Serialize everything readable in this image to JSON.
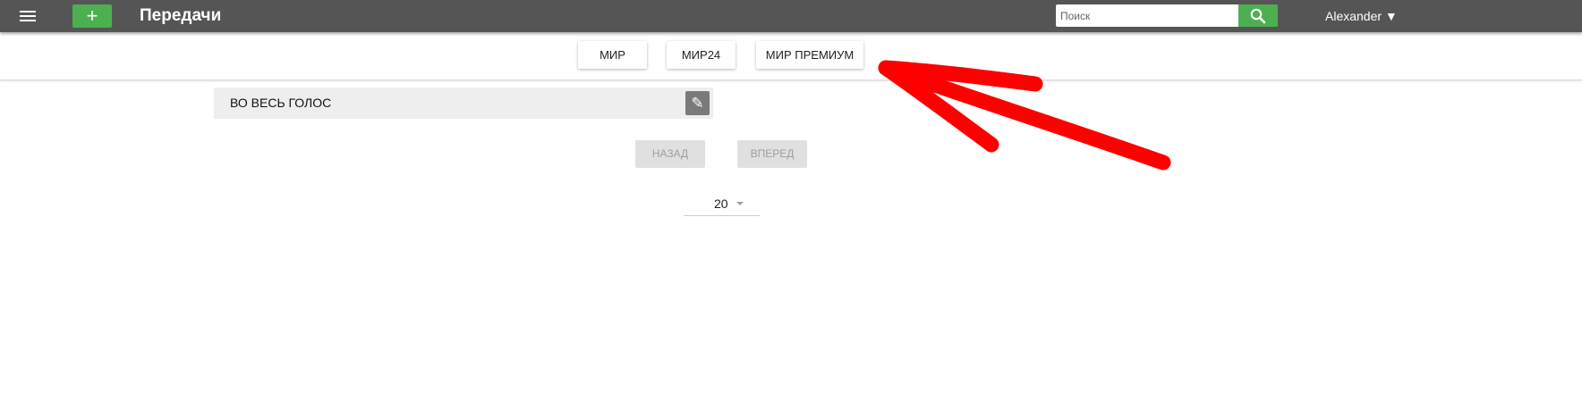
{
  "header": {
    "title": "Передачи",
    "add_label": "+",
    "search_placeholder": "Поиск",
    "user_label": "Alexander ▼"
  },
  "channels": [
    {
      "label": "МИР"
    },
    {
      "label": "МИР24"
    },
    {
      "label": "МИР ПРЕМИУМ"
    }
  ],
  "programs": [
    {
      "name": "ВО ВЕСЬ ГОЛОС",
      "edit_icon": "pencil-icon"
    }
  ],
  "pagination": {
    "back_label": "НАЗАД",
    "forward_label": "ВПЕРЕД",
    "page_size": "20"
  },
  "colors": {
    "topbar": "#555555",
    "accent_green": "#4caf50",
    "annotation_red": "#ff0000"
  },
  "icons": {
    "menu": "menu-icon",
    "search": "search-icon",
    "edit": "pencil-icon",
    "dropdown": "chevron-down-icon"
  }
}
